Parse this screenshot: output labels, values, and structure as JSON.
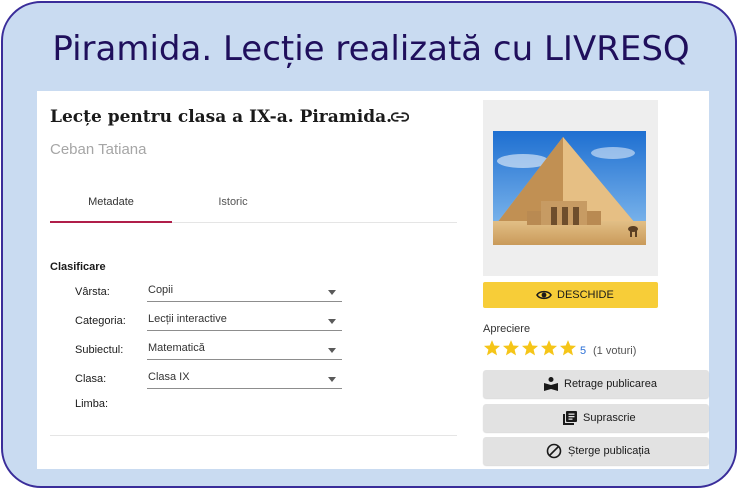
{
  "header": {
    "title": "Piramida. Lecție realizată cu LIVRESQ"
  },
  "lesson": {
    "title": "Lecțe pentru clasa a IX-a. Piramida.",
    "author": "Ceban Tatiana"
  },
  "tabs": [
    {
      "label": "Metadate",
      "active": true
    },
    {
      "label": "Istoric",
      "active": false
    }
  ],
  "classification": {
    "title": "Clasificare",
    "fields": [
      {
        "label": "Vârsta:",
        "value": "Copii"
      },
      {
        "label": "Categoria:",
        "value": "Lecții interactive"
      },
      {
        "label": "Subiectul:",
        "value": "Matematică"
      },
      {
        "label": "Clasa:",
        "value": "Clasa IX"
      },
      {
        "label": "Limba:",
        "value": ""
      }
    ]
  },
  "actions": {
    "open_label": "DESCHIDE",
    "rating_label": "Apreciere",
    "rating_value": "5",
    "rating_votes": "(1 voturi)",
    "stars": 5,
    "unpublish_label": "Retrage publicarea",
    "overwrite_label": "Suprascrie",
    "delete_label": "Șterge publicația"
  },
  "colors": {
    "frame_bg": "#c9dbf1",
    "frame_border": "#3a2d9a",
    "title_color": "#1f0f5c",
    "accent_tab": "#b01e4a",
    "open_button": "#f7cd38",
    "star": "#f5c518",
    "rating_value": "#2a6fd6"
  }
}
